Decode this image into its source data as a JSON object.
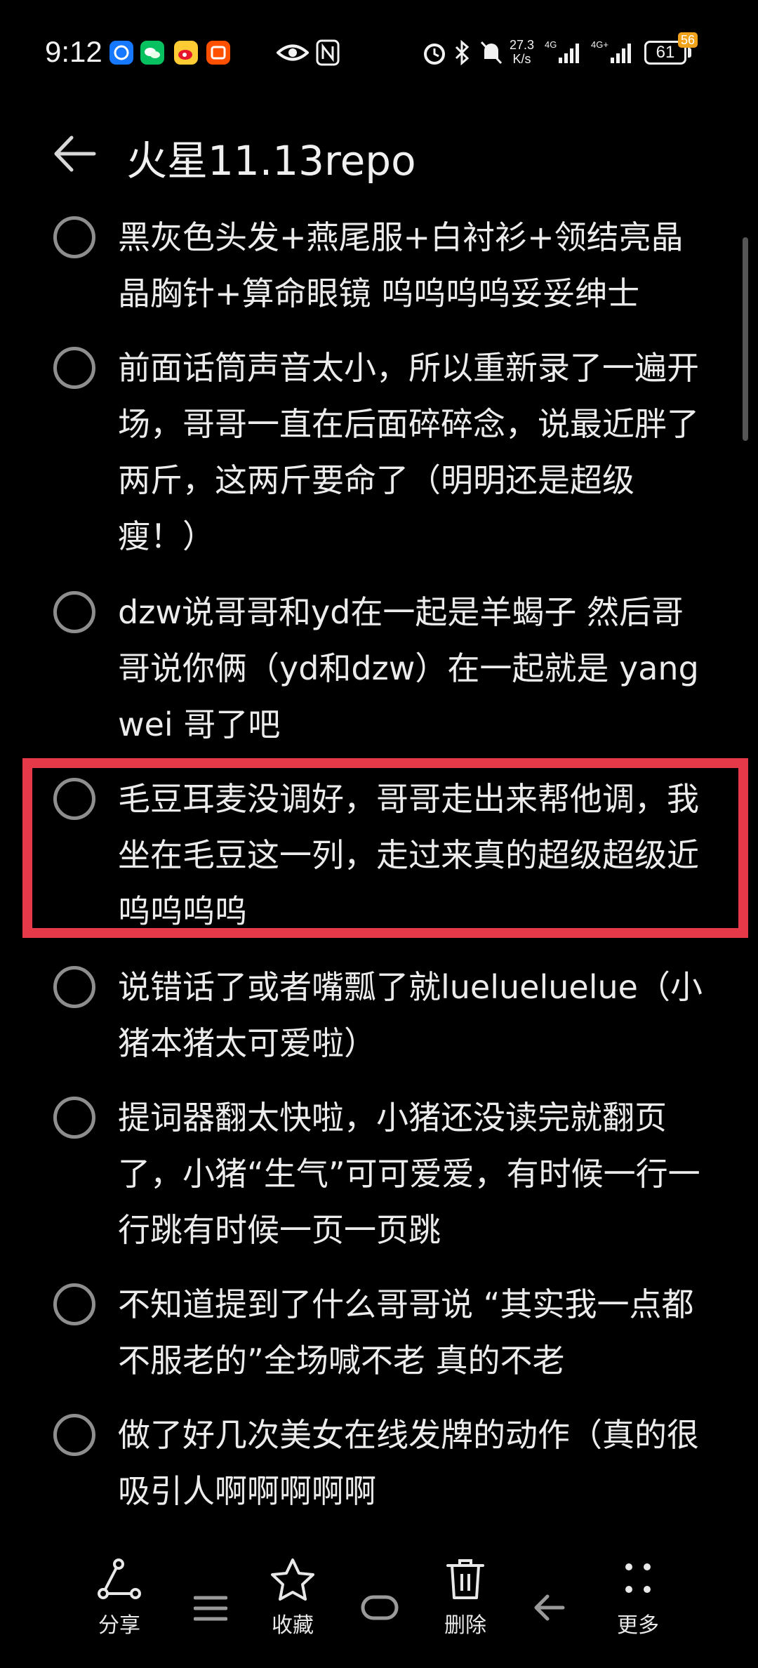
{
  "status_bar": {
    "time": "9:12",
    "net_speed_value": "27.3",
    "net_speed_unit": "K/s",
    "battery": "61",
    "badge": "56"
  },
  "header": {
    "title": "火星11.13repo"
  },
  "items": [
    {
      "text": "黑灰色头发+燕尾服+白衬衫+领结亮晶晶胸针+算命眼镜   呜呜呜呜妥妥绅士"
    },
    {
      "text": "前面话筒声音太小，所以重新录了一遍开场，哥哥一直在后面碎碎念，说最近胖了两斤，这两斤要命了（明明还是超级瘦！）"
    },
    {
      "text": "dzw说哥哥和yd在一起是羊蝎子 然后哥哥说你俩（yd和dzw）在一起就是 yang wei 哥了吧"
    },
    {
      "text": "毛豆耳麦没调好，哥哥走出来帮他调，我坐在毛豆这一列，走过来真的超级超级近呜呜呜呜"
    },
    {
      "text": "说错话了或者嘴瓢了就luelueluelue（小猪本猪太可爱啦）"
    },
    {
      "text": "提词器翻太快啦，小猪还没读完就翻页了，小猪“生气”可可爱爱，有时候一行一行跳有时候一页一页跳"
    },
    {
      "text": "不知道提到了什么哥哥说 “其实我一点都不服老的”全场喊不老 真的不老"
    },
    {
      "text": "做了好几次美女在线发牌的动作（真的很吸引人啊啊啊啊啊"
    }
  ],
  "bottom_bar": {
    "share_label": "分享",
    "favorite_label": "收藏",
    "delete_label": "删除",
    "more_label": "更多"
  },
  "colors": {
    "background": "#000000",
    "text": "#ececec",
    "highlight": "#e5394a",
    "checkbox": "#8e8e8e"
  }
}
